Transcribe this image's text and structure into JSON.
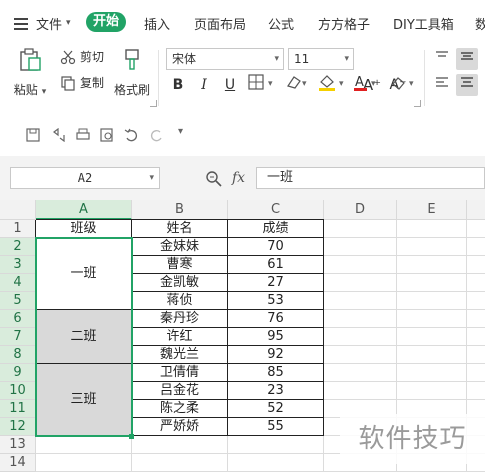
{
  "menubar": {
    "file_label": "文件",
    "tabs": [
      "开始",
      "插入",
      "页面布局",
      "公式",
      "方方格子",
      "DIY工具箱",
      "数"
    ]
  },
  "ribbon": {
    "paste_label": "粘贴",
    "cut_label": "剪切",
    "copy_label": "复制",
    "format_painter_label": "格式刷",
    "font_name": "宋体",
    "font_size": "11",
    "bold": "B",
    "italic": "I",
    "underline": "U",
    "grow_font": "A⁺",
    "shrink_font": "A⁻"
  },
  "formula_bar": {
    "cell_ref": "A2",
    "fx_label": "fx",
    "content": "一班"
  },
  "sheet": {
    "columns": [
      "A",
      "B",
      "C",
      "D",
      "E"
    ],
    "rows": [
      "1",
      "2",
      "3",
      "4",
      "5",
      "6",
      "7",
      "8",
      "9",
      "10",
      "11",
      "12",
      "13",
      "14"
    ],
    "header": {
      "class": "班级",
      "name": "姓名",
      "score": "成绩"
    },
    "classes": [
      "一班",
      "二班",
      "三班"
    ],
    "students": [
      {
        "name": "金妹妹",
        "score": "70"
      },
      {
        "name": "曹寒",
        "score": "61"
      },
      {
        "name": "金凯敏",
        "score": "27"
      },
      {
        "name": "蒋侦",
        "score": "53"
      },
      {
        "name": "秦丹珍",
        "score": "76"
      },
      {
        "name": "许红",
        "score": "95"
      },
      {
        "name": "魏光兰",
        "score": "92"
      },
      {
        "name": "卫倩倩",
        "score": "85"
      },
      {
        "name": "吕金花",
        "score": "23"
      },
      {
        "name": "陈之柔",
        "score": "52"
      },
      {
        "name": "严娇娇",
        "score": "55"
      }
    ]
  },
  "watermark": "软件技巧",
  "colors": {
    "accent": "#21a366",
    "shade": "#d9d9d9"
  }
}
